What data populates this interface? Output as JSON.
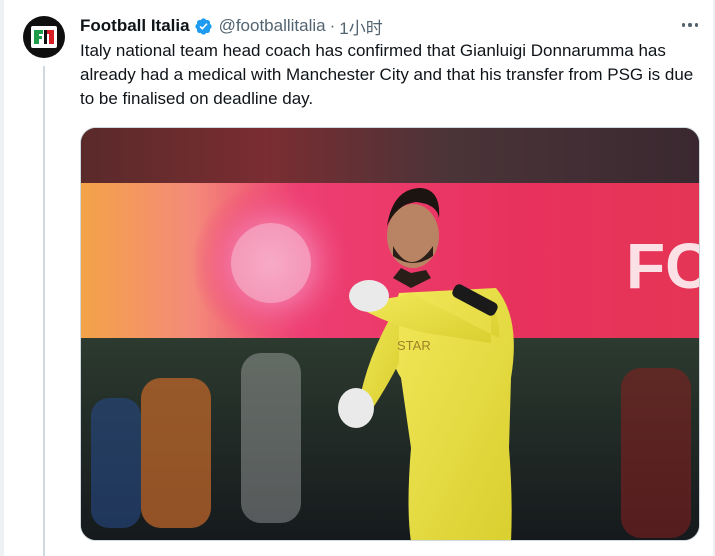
{
  "tweet": {
    "author_name": "Football Italia",
    "handle": "@footballitalia",
    "separator": "·",
    "timestamp": "1小时",
    "text": "Italy national team head coach has confirmed that Gianluigi Donnarumma has already had a medical with Manchester City and that his transfer from PSG is due to be finalised on deadline day.",
    "verified": true,
    "avatar_icon": "football-italia-logo-icon",
    "more_icon": "more-options-icon",
    "media": {
      "kind": "photo",
      "subject_description": "goalkeeper in yellow kit celebrating with clenched fist"
    }
  },
  "colors": {
    "text_primary": "#0f1419",
    "text_secondary": "#536471",
    "verified_blue": "#1d9bf0",
    "thread_line": "#cfd9de",
    "logo_red": "#d81f26",
    "logo_green": "#1e9c4a"
  }
}
